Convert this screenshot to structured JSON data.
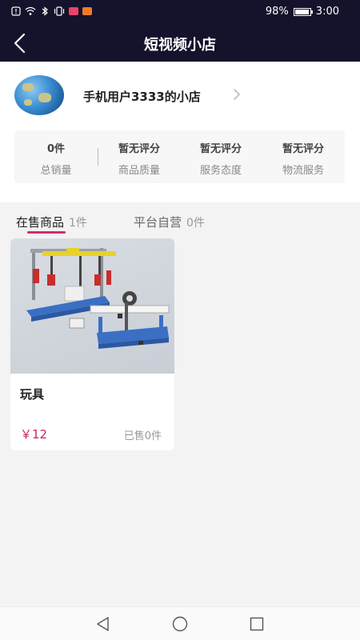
{
  "status_bar": {
    "battery_percent": "98%",
    "time": "3:00",
    "icons": [
      "alert-icon",
      "wifi-icon",
      "bluetooth-icon",
      "vibrate-icon",
      "red-notification-icon",
      "orange-notification-icon"
    ]
  },
  "nav": {
    "title": "短视频小店",
    "back_icon": "chevron-left-icon"
  },
  "shop": {
    "name": "手机用户3333的小店",
    "stats": [
      {
        "value": "0件",
        "label": "总销量"
      },
      {
        "value": "暂无评分",
        "label": "商品质量"
      },
      {
        "value": "暂无评分",
        "label": "服务态度"
      },
      {
        "value": "暂无评分",
        "label": "物流服务"
      }
    ]
  },
  "tabs": [
    {
      "label": "在售商品",
      "count": "1件",
      "active": true
    },
    {
      "label": "平台自营",
      "count": "0件",
      "active": false
    }
  ],
  "products": [
    {
      "name": "玩具",
      "price": "￥12",
      "sold": "已售0件"
    }
  ],
  "system_nav": [
    "back-triangle-icon",
    "home-circle-icon",
    "recents-square-icon"
  ],
  "colors": {
    "header_bg": "#15122b",
    "accent": "#d42a70",
    "price": "#c8246a"
  }
}
